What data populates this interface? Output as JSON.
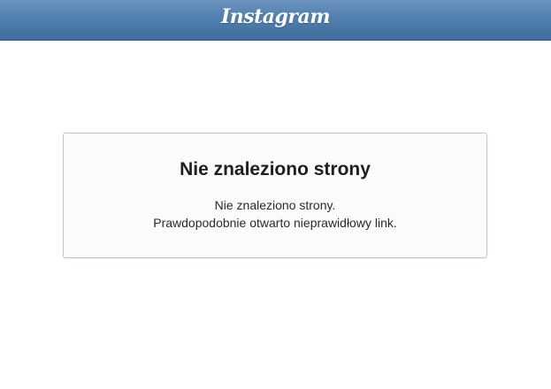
{
  "header": {
    "logo_text": "Instagram"
  },
  "error": {
    "title": "Nie znaleziono strony",
    "line1": "Nie znaleziono strony.",
    "line2": "Prawdopodobnie otwarto nieprawidłowy link."
  }
}
